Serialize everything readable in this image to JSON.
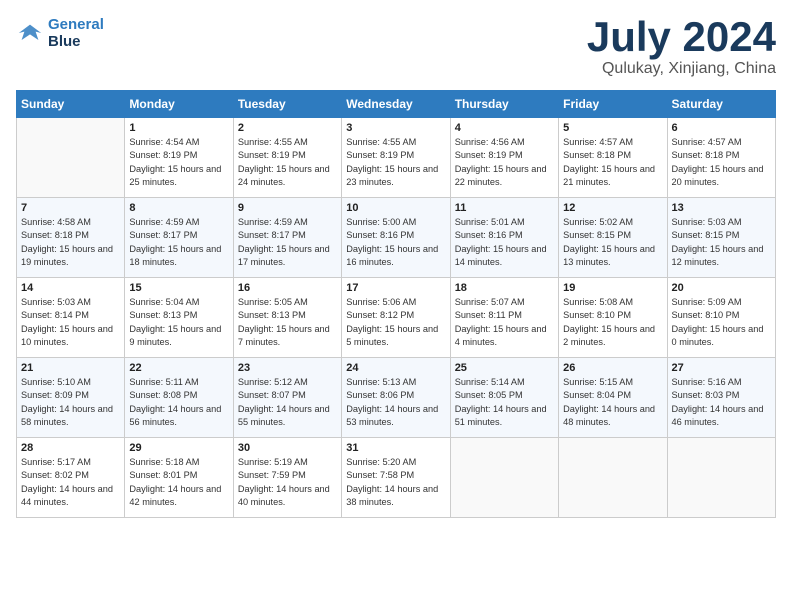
{
  "header": {
    "logo_line1": "General",
    "logo_line2": "Blue",
    "month_title": "July 2024",
    "location": "Qulukay, Xinjiang, China"
  },
  "days_of_week": [
    "Sunday",
    "Monday",
    "Tuesday",
    "Wednesday",
    "Thursday",
    "Friday",
    "Saturday"
  ],
  "weeks": [
    [
      {
        "day": "",
        "empty": true
      },
      {
        "day": "1",
        "sunrise": "4:54 AM",
        "sunset": "8:19 PM",
        "daylight": "15 hours and 25 minutes."
      },
      {
        "day": "2",
        "sunrise": "4:55 AM",
        "sunset": "8:19 PM",
        "daylight": "15 hours and 24 minutes."
      },
      {
        "day": "3",
        "sunrise": "4:55 AM",
        "sunset": "8:19 PM",
        "daylight": "15 hours and 23 minutes."
      },
      {
        "day": "4",
        "sunrise": "4:56 AM",
        "sunset": "8:19 PM",
        "daylight": "15 hours and 22 minutes."
      },
      {
        "day": "5",
        "sunrise": "4:57 AM",
        "sunset": "8:18 PM",
        "daylight": "15 hours and 21 minutes."
      },
      {
        "day": "6",
        "sunrise": "4:57 AM",
        "sunset": "8:18 PM",
        "daylight": "15 hours and 20 minutes."
      }
    ],
    [
      {
        "day": "7",
        "sunrise": "4:58 AM",
        "sunset": "8:18 PM",
        "daylight": "15 hours and 19 minutes."
      },
      {
        "day": "8",
        "sunrise": "4:59 AM",
        "sunset": "8:17 PM",
        "daylight": "15 hours and 18 minutes."
      },
      {
        "day": "9",
        "sunrise": "4:59 AM",
        "sunset": "8:17 PM",
        "daylight": "15 hours and 17 minutes."
      },
      {
        "day": "10",
        "sunrise": "5:00 AM",
        "sunset": "8:16 PM",
        "daylight": "15 hours and 16 minutes."
      },
      {
        "day": "11",
        "sunrise": "5:01 AM",
        "sunset": "8:16 PM",
        "daylight": "15 hours and 14 minutes."
      },
      {
        "day": "12",
        "sunrise": "5:02 AM",
        "sunset": "8:15 PM",
        "daylight": "15 hours and 13 minutes."
      },
      {
        "day": "13",
        "sunrise": "5:03 AM",
        "sunset": "8:15 PM",
        "daylight": "15 hours and 12 minutes."
      }
    ],
    [
      {
        "day": "14",
        "sunrise": "5:03 AM",
        "sunset": "8:14 PM",
        "daylight": "15 hours and 10 minutes."
      },
      {
        "day": "15",
        "sunrise": "5:04 AM",
        "sunset": "8:13 PM",
        "daylight": "15 hours and 9 minutes."
      },
      {
        "day": "16",
        "sunrise": "5:05 AM",
        "sunset": "8:13 PM",
        "daylight": "15 hours and 7 minutes."
      },
      {
        "day": "17",
        "sunrise": "5:06 AM",
        "sunset": "8:12 PM",
        "daylight": "15 hours and 5 minutes."
      },
      {
        "day": "18",
        "sunrise": "5:07 AM",
        "sunset": "8:11 PM",
        "daylight": "15 hours and 4 minutes."
      },
      {
        "day": "19",
        "sunrise": "5:08 AM",
        "sunset": "8:10 PM",
        "daylight": "15 hours and 2 minutes."
      },
      {
        "day": "20",
        "sunrise": "5:09 AM",
        "sunset": "8:10 PM",
        "daylight": "15 hours and 0 minutes."
      }
    ],
    [
      {
        "day": "21",
        "sunrise": "5:10 AM",
        "sunset": "8:09 PM",
        "daylight": "14 hours and 58 minutes."
      },
      {
        "day": "22",
        "sunrise": "5:11 AM",
        "sunset": "8:08 PM",
        "daylight": "14 hours and 56 minutes."
      },
      {
        "day": "23",
        "sunrise": "5:12 AM",
        "sunset": "8:07 PM",
        "daylight": "14 hours and 55 minutes."
      },
      {
        "day": "24",
        "sunrise": "5:13 AM",
        "sunset": "8:06 PM",
        "daylight": "14 hours and 53 minutes."
      },
      {
        "day": "25",
        "sunrise": "5:14 AM",
        "sunset": "8:05 PM",
        "daylight": "14 hours and 51 minutes."
      },
      {
        "day": "26",
        "sunrise": "5:15 AM",
        "sunset": "8:04 PM",
        "daylight": "14 hours and 48 minutes."
      },
      {
        "day": "27",
        "sunrise": "5:16 AM",
        "sunset": "8:03 PM",
        "daylight": "14 hours and 46 minutes."
      }
    ],
    [
      {
        "day": "28",
        "sunrise": "5:17 AM",
        "sunset": "8:02 PM",
        "daylight": "14 hours and 44 minutes."
      },
      {
        "day": "29",
        "sunrise": "5:18 AM",
        "sunset": "8:01 PM",
        "daylight": "14 hours and 42 minutes."
      },
      {
        "day": "30",
        "sunrise": "5:19 AM",
        "sunset": "7:59 PM",
        "daylight": "14 hours and 40 minutes."
      },
      {
        "day": "31",
        "sunrise": "5:20 AM",
        "sunset": "7:58 PM",
        "daylight": "14 hours and 38 minutes."
      },
      {
        "day": "",
        "empty": true
      },
      {
        "day": "",
        "empty": true
      },
      {
        "day": "",
        "empty": true
      }
    ]
  ],
  "labels": {
    "sunrise_prefix": "Sunrise: ",
    "sunset_prefix": "Sunset: ",
    "daylight_prefix": "Daylight: "
  }
}
